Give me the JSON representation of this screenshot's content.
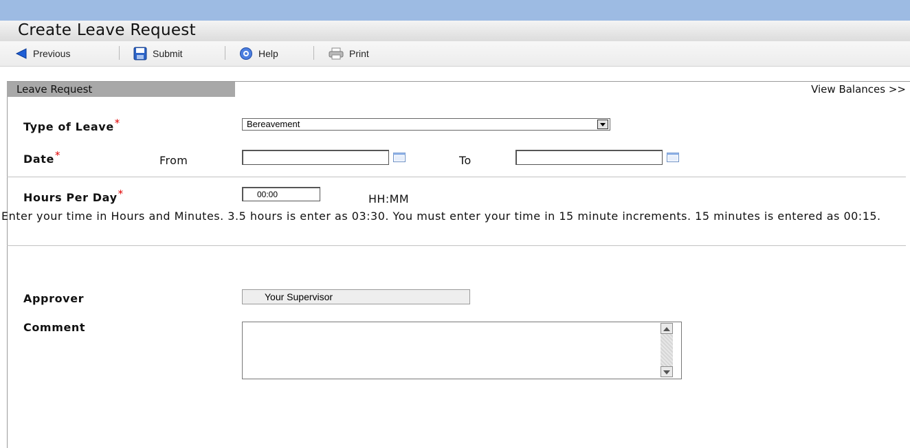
{
  "header": {
    "title": "Create Leave Request"
  },
  "toolbar": {
    "previous_label": "Previous",
    "submit_label": "Submit",
    "help_label": "Help",
    "print_label": "Print"
  },
  "panel": {
    "tab_label": "Leave Request",
    "view_balances_label": "View Balances >>"
  },
  "form": {
    "type_of_leave": {
      "label": "Type of Leave",
      "required": "*",
      "selected": "Bereavement"
    },
    "date": {
      "label": "Date",
      "required": "*",
      "from_label": "From",
      "to_label": "To",
      "from_value": "",
      "to_value": ""
    },
    "hours_per_day": {
      "label": "Hours Per Day",
      "required": "*",
      "value": "00:00",
      "format_hint": "HH:MM"
    },
    "help_text": "Enter your time in Hours and Minutes. 3.5 hours is enter as 03:30. You must enter your time in 15 minute increments. 15 minutes is entered as 00:15.",
    "approver": {
      "label": "Approver",
      "value": "Your Supervisor"
    },
    "comment": {
      "label": "Comment",
      "value": ""
    }
  },
  "colors": {
    "top_bar": "#9dbbe3",
    "tab_background": "#a8a8a8",
    "required_marker": "#e00000"
  }
}
